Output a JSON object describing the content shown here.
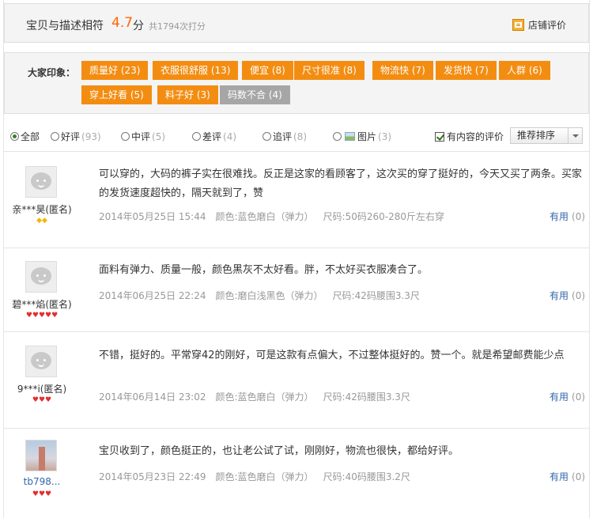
{
  "summary": {
    "label": "宝贝与描述相符",
    "score": "4.7",
    "unit": "分",
    "count_text": "共1794次打分",
    "shop_rating": "店铺评价"
  },
  "impressions": {
    "title": "大家印象：",
    "tags": [
      {
        "label": "质量好 (23)",
        "style": "orange"
      },
      {
        "label": "衣服很舒服 (13)",
        "style": "orange"
      },
      {
        "label": "便宜 (8)",
        "style": "orange"
      },
      {
        "label": "尺寸很准 (8)",
        "style": "orange"
      },
      {
        "label": "物流快 (7)",
        "style": "orange"
      },
      {
        "label": "发货快 (7)",
        "style": "orange"
      },
      {
        "label": "人群 (6)",
        "style": "orange"
      },
      {
        "label": "穿上好看 (5)",
        "style": "orange"
      },
      {
        "label": "料子好 (3)",
        "style": "orange"
      },
      {
        "label": "码数不合 (4)",
        "style": "gray"
      }
    ]
  },
  "filters": {
    "options": [
      {
        "label": "全部",
        "count": "",
        "selected": true
      },
      {
        "label": "好评",
        "count": "(93)",
        "selected": false
      },
      {
        "label": "中评",
        "count": "(5)",
        "selected": false
      },
      {
        "label": "差评",
        "count": "(4)",
        "selected": false
      },
      {
        "label": "追评",
        "count": "(8)",
        "selected": false
      },
      {
        "label": "图片",
        "count": "(3)",
        "selected": false
      }
    ],
    "has_content_label": "有内容的评价",
    "has_content_checked": true,
    "sort_label": "推荐排序"
  },
  "reviews": [
    {
      "user": "亲***昊(匿名)",
      "badges": "◆◆",
      "badge_color": "yellow",
      "content": "可以穿的，大码的裤子实在很难找。反正是这家的看顾客了，这次买的穿了挺好的，今天又买了两条。买家的发货速度超快的，隔天就到了，赞",
      "date": "2014年05月25日 15:44",
      "color": "颜色:蓝色磨白（弹力）",
      "size": "尺码:50码260-280斤左右穿",
      "useful": "有用",
      "useful_count": "(0)"
    },
    {
      "user": "碧***焰(匿名)",
      "badges": "♥♥♥♥♥",
      "badge_color": "red",
      "content": "面料有弹力、质量一般，颜色黑灰不太好看。胖，不太好买衣服凑合了。",
      "date": "2014年06月25日 22:24",
      "color": "颜色:磨白浅黑色（弹力）",
      "size": "尺码:42码腰围3.3尺",
      "useful": "有用",
      "useful_count": "(0)"
    },
    {
      "user": "9***i(匿名)",
      "badges": "♥♥♥",
      "badge_color": "red",
      "content": "不错，挺好的。平常穿42的刚好，可是这款有点偏大，不过整体挺好的。赞一个。就是希望邮费能少点",
      "date": "2014年06月14日 23:02",
      "color": "颜色:蓝色磨白（弹力）",
      "size": "尺码:42码腰围3.3尺",
      "useful": "有用",
      "useful_count": "(0)"
    },
    {
      "user": "tb798...",
      "badges": "♥♥♥",
      "badge_color": "red",
      "content": "宝贝收到了，颜色挺正的，也让老公试了试，刚刚好，物流也很快，都给好评。",
      "date": "2014年05月23日 22:49",
      "color": "颜色:蓝色磨白（弹力）",
      "size": "尺码:40码腰围3.2尺",
      "useful": "有用",
      "useful_count": "(0)"
    }
  ]
}
